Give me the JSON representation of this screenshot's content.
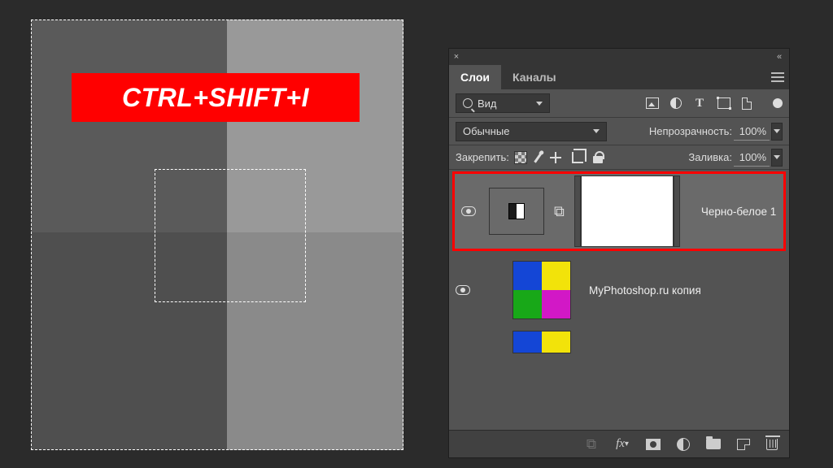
{
  "banner": {
    "text": "CTRL+SHIFT+I"
  },
  "panel": {
    "tabs": {
      "layers": "Слои",
      "channels": "Каналы"
    },
    "filter_dd_label": "Вид",
    "blend_mode": "Обычные",
    "opacity_label": "Непрозрачность:",
    "opacity_value": "100%",
    "lock_label": "Закрепить:",
    "fill_label": "Заливка:",
    "fill_value": "100%"
  },
  "layers": [
    {
      "name": "Черно-белое 1",
      "kind": "adjustment",
      "visible": true,
      "selected": true
    },
    {
      "name": "MyPhotoshop.ru копия",
      "kind": "image",
      "visible": true,
      "selected": false
    },
    {
      "name": "",
      "kind": "image-partial",
      "visible": false,
      "selected": false
    }
  ],
  "colors": {
    "accent_red": "#ff0000",
    "tile_blue": "#1446d6",
    "tile_yellow": "#f2e30a",
    "tile_green": "#18a818",
    "tile_magenta": "#d218c6"
  }
}
